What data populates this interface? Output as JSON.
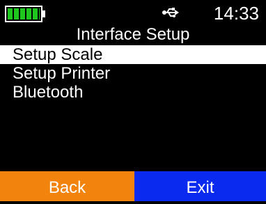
{
  "status": {
    "battery_icon": "battery-full-icon",
    "battery_color": "#1ec81e",
    "usb_icon": "usb-icon",
    "time": "14:33"
  },
  "screen": {
    "title": "Interface Setup"
  },
  "menu": {
    "items": [
      {
        "label": "Setup Scale",
        "selected": true
      },
      {
        "label": "Setup Printer",
        "selected": false
      },
      {
        "label": "Bluetooth",
        "selected": false
      }
    ]
  },
  "softkeys": {
    "back_label": "Back",
    "back_color": "#f2840e",
    "exit_label": "Exit",
    "exit_color": "#0b2af0"
  }
}
